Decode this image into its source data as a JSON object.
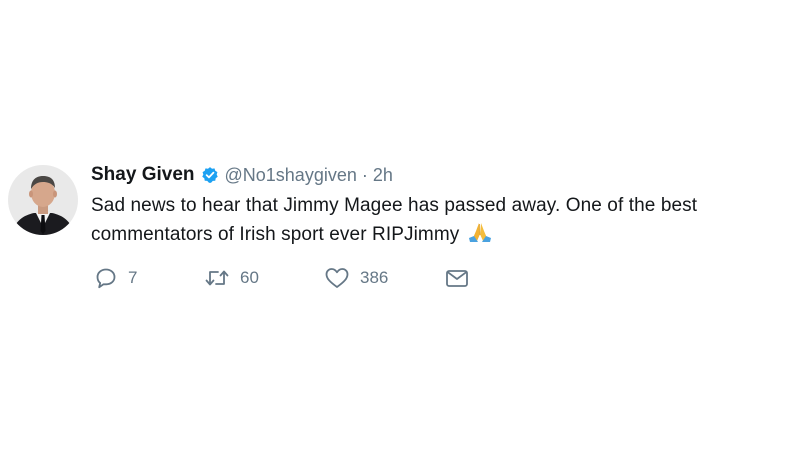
{
  "tweet": {
    "display_name": "Shay Given",
    "handle": "@No1shaygiven",
    "separator": "·",
    "time": "2h",
    "text_line_1": "Sad news to hear that Jimmy Magee has passed away. One of the best",
    "text_line_2": "commentators of Irish sport ever RIPJimmy",
    "emoji": "folded-hands-emoji"
  },
  "actions": {
    "reply_count": "7",
    "retweet_count": "60",
    "like_count": "386"
  },
  "colors": {
    "text": "#14171a",
    "secondary": "#657786",
    "verified": "#1da1f2"
  },
  "icons": [
    "verified-icon",
    "reply-icon",
    "retweet-icon",
    "like-icon",
    "message-icon"
  ]
}
